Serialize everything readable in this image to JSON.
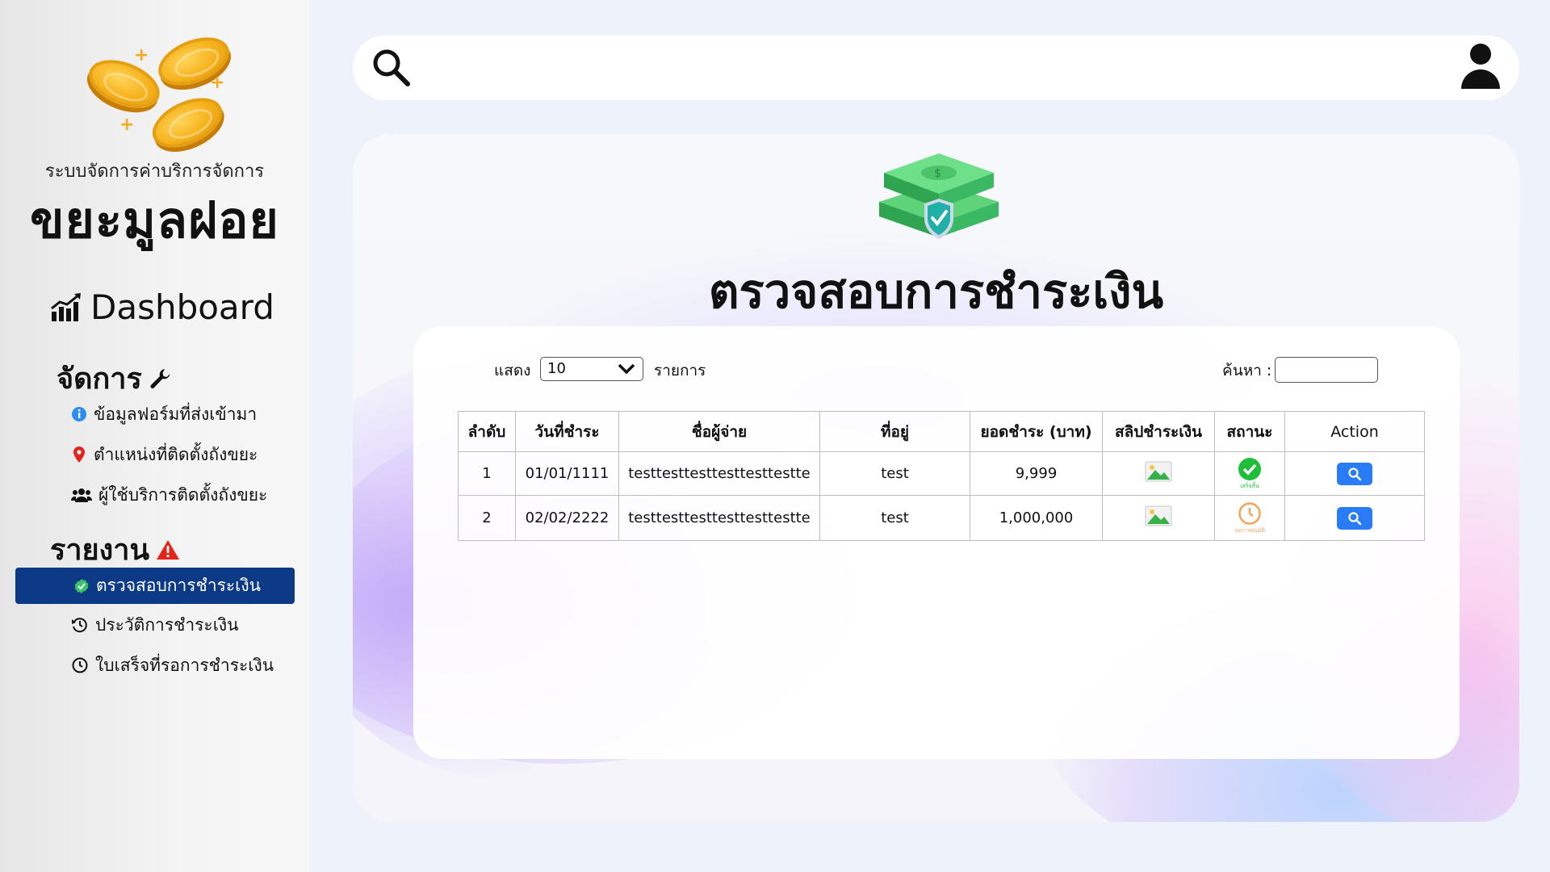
{
  "app": {
    "subtitle": "ระบบจัดการค่าบริการจัดการ",
    "title": "ขยะมูลฝอย"
  },
  "sidebar": {
    "dashboard_label": "Dashboard",
    "manage_section": "จัดการ",
    "manage_items": [
      {
        "label": "ข้อมูลฟอร์มที่ส่งเข้ามา",
        "icon": "info-icon"
      },
      {
        "label": "ตำแหน่งที่ติดตั้งถังขยะ",
        "icon": "map-pin-icon"
      },
      {
        "label": "ผู้ใช้บริการติดตั้งถังขยะ",
        "icon": "users-icon"
      }
    ],
    "report_section": "รายงาน",
    "report_items": [
      {
        "label": "ตรวจสอบการชำระเงิน",
        "icon": "verified-badge-icon",
        "active": true
      },
      {
        "label": "ประวัติการชำระเงิน",
        "icon": "history-icon"
      },
      {
        "label": "ใบเสร็จที่รอการชำระเงิน",
        "icon": "clock-icon"
      }
    ]
  },
  "topbar": {
    "search_icon": "search-icon",
    "user_icon": "user-icon"
  },
  "main": {
    "page_title": "ตรวจสอบการชำระเงิน",
    "controls": {
      "show_label": "แสดง",
      "entries_value": "10",
      "entries_label": "รายการ",
      "search_label": "ค้นหา :",
      "search_value": ""
    },
    "table": {
      "headers": [
        "ลำดับ",
        "วันที่ชำระ",
        "ชื่อผู้จ่าย",
        "ที่อยู่",
        "ยอดชำระ (บาท)",
        "สลิปชำระเงิน",
        "สถานะ",
        "Action"
      ],
      "rows": [
        {
          "no": "1",
          "date": "01/01/1111",
          "payer": "testtesttesttesttesttestte",
          "address": "test",
          "amount": "9,999",
          "slip_icon": "image-icon",
          "status": "เสร็จสิ้น",
          "status_icon": "check-circle-icon",
          "action_icon": "search-icon"
        },
        {
          "no": "2",
          "date": "02/02/2222",
          "payer": "testtesttesttesttesttestte",
          "address": "test",
          "amount": "1,000,000",
          "slip_icon": "image-icon",
          "status": "รอการอนุมัติ",
          "status_icon": "clock-icon",
          "action_icon": "search-icon"
        }
      ]
    }
  },
  "colors": {
    "active_nav": "#0d3a86",
    "action_button": "#2a7cf6",
    "status_done": "#1fbf3a",
    "status_pending": "#f5a25a",
    "alert_red": "#e2241b"
  }
}
